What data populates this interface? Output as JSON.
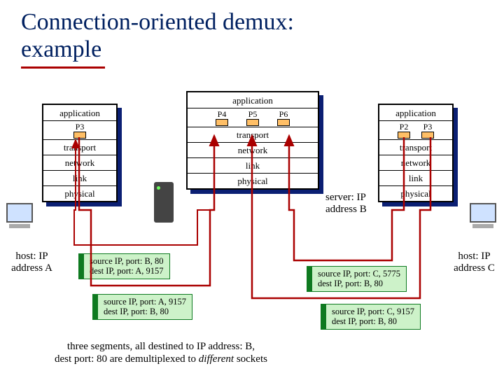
{
  "title_line1": "Connection-oriented demux:",
  "title_line2": "example",
  "layers": {
    "application": "application",
    "transport": "transport",
    "network": "network",
    "link": "link",
    "physical": "physical"
  },
  "left_stack": {
    "procs": [
      {
        "label": "P3"
      }
    ]
  },
  "center_stack": {
    "procs": [
      {
        "label": "P4"
      },
      {
        "label": "P5"
      },
      {
        "label": "P6"
      }
    ]
  },
  "right_stack": {
    "procs": [
      {
        "label": "P2"
      },
      {
        "label": "P3"
      }
    ]
  },
  "host_a_label": "host: IP address A",
  "server_b_label": "server: IP address B",
  "host_c_label": "host: IP address C",
  "packets": {
    "b_to_a": {
      "l1": "source IP, port: B, 80",
      "l2": "dest IP, port: A, 9157"
    },
    "a_to_b": {
      "l1": "source IP, port: A, 9157",
      "l2": "dest IP,  port: B, 80"
    },
    "c_to_b_1": {
      "l1": "source IP, port: C, 5775",
      "l2": "dest IP, port: B, 80"
    },
    "c_to_b_2": {
      "l1": "source IP, port: C, 9157",
      "l2": "dest IP, port: B, 80"
    }
  },
  "caption": {
    "l1": "three segments, all destined to IP address: B,",
    "l2_a": "dest port: 80 are demultiplexed to ",
    "l2_b": "different",
    "l2_c": " sockets"
  },
  "chart_data": {
    "type": "diagram",
    "title": "Connection-oriented demux: example",
    "hosts": [
      {
        "id": "A",
        "role": "client",
        "label": "host: IP address A",
        "processes": [
          "P3"
        ]
      },
      {
        "id": "B",
        "role": "server",
        "label": "server: IP address B",
        "processes": [
          "P4",
          "P5",
          "P6"
        ]
      },
      {
        "id": "C",
        "role": "client",
        "label": "host: IP address C",
        "processes": [
          "P2",
          "P3"
        ]
      }
    ],
    "layer_stack": [
      "application",
      "transport",
      "network",
      "link",
      "physical"
    ],
    "segments": [
      {
        "source_ip": "B",
        "source_port": 80,
        "dest_ip": "A",
        "dest_port": 9157
      },
      {
        "source_ip": "A",
        "source_port": 9157,
        "dest_ip": "B",
        "dest_port": 80
      },
      {
        "source_ip": "C",
        "source_port": 5775,
        "dest_ip": "B",
        "dest_port": 80
      },
      {
        "source_ip": "C",
        "source_port": 9157,
        "dest_ip": "B",
        "dest_port": 80
      }
    ],
    "caption": "three segments, all destined to IP address: B, dest port: 80 are demultiplexed to different sockets"
  }
}
